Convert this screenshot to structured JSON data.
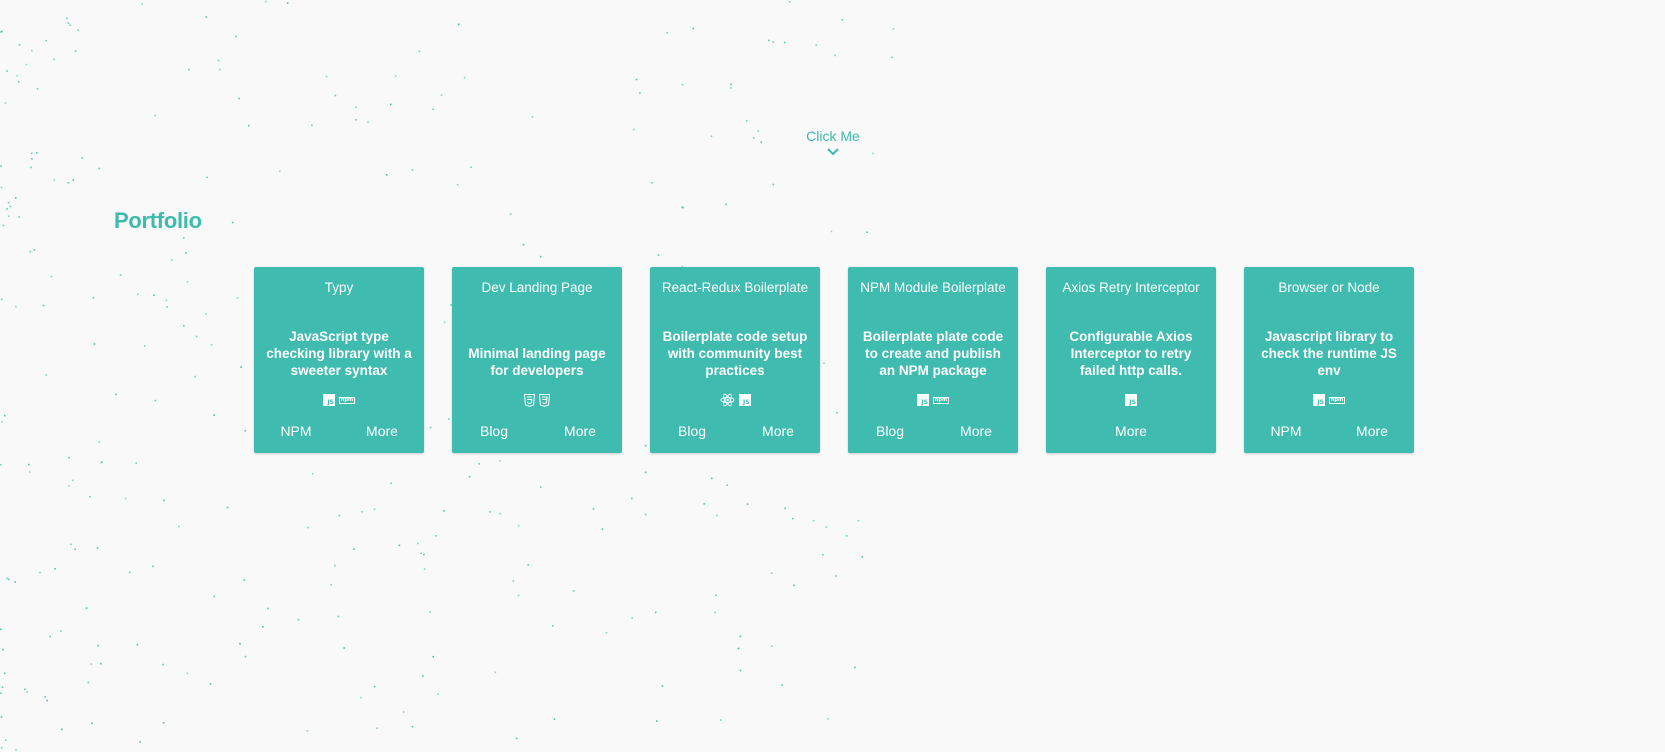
{
  "header": {
    "click_me_label": "Click Me"
  },
  "portfolio": {
    "title": "Portfolio",
    "cards": [
      {
        "title": "Typy",
        "description": "JavaScript type checking library with a sweeter syntax",
        "icons": [
          "js-icon",
          "npm-icon"
        ],
        "links": [
          "NPM",
          "More"
        ]
      },
      {
        "title": "Dev Landing Page",
        "description": "Minimal landing page for developers",
        "icons": [
          "html5-icon",
          "css3-icon"
        ],
        "links": [
          "Blog",
          "More"
        ]
      },
      {
        "title": "React-Redux Boilerplate",
        "description": "Boilerplate code setup with community best practices",
        "icons": [
          "react-icon",
          "js-icon"
        ],
        "links": [
          "Blog",
          "More"
        ]
      },
      {
        "title": "NPM Module Boilerplate",
        "description": "Boilerplate plate code to create and publish an NPM package",
        "icons": [
          "js-icon",
          "npm-icon"
        ],
        "links": [
          "Blog",
          "More"
        ]
      },
      {
        "title": "Axios Retry Interceptor",
        "description": "Configurable Axios Interceptor to retry failed http calls.",
        "icons": [
          "js-icon"
        ],
        "links": [
          "More"
        ]
      },
      {
        "title": "Browser or Node",
        "description": "Javascript library to check the runtime JS env",
        "icons": [
          "js-icon",
          "npm-icon"
        ],
        "links": [
          "NPM",
          "More"
        ]
      }
    ]
  },
  "theme": {
    "accent": "#3dbbad",
    "card_bg": "#3fbbaf",
    "background": "#f9f9f9",
    "particle_color": "#3dbbad"
  },
  "icon_text": {
    "js": "JS",
    "npm": "npm"
  }
}
